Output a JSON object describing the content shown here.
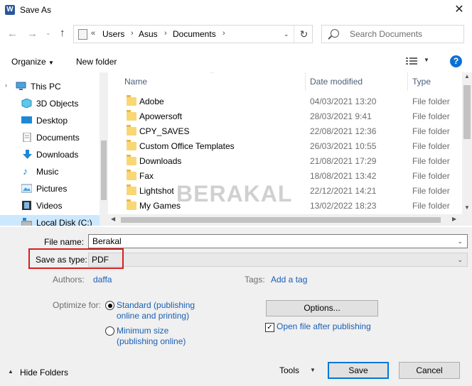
{
  "window": {
    "title": "Save As",
    "app_icon_letter": "W"
  },
  "address": {
    "prefix": "«",
    "crumbs": [
      "Users",
      "Asus",
      "Documents"
    ]
  },
  "search": {
    "placeholder": "Search Documents"
  },
  "toolbar": {
    "organize": "Organize",
    "new_folder": "New folder"
  },
  "nav": {
    "items": [
      {
        "label": "This PC",
        "icon": "pc-icon"
      },
      {
        "label": "3D Objects",
        "icon": "cube-icon"
      },
      {
        "label": "Desktop",
        "icon": "desktop-icon"
      },
      {
        "label": "Documents",
        "icon": "documents-icon"
      },
      {
        "label": "Downloads",
        "icon": "download-arrow-icon"
      },
      {
        "label": "Music",
        "icon": "music-note-icon"
      },
      {
        "label": "Pictures",
        "icon": "pictures-icon"
      },
      {
        "label": "Videos",
        "icon": "film-icon"
      },
      {
        "label": "Local Disk (C:)",
        "icon": "drive-icon"
      }
    ]
  },
  "files": {
    "columns": {
      "name": "Name",
      "date": "Date modified",
      "type": "Type"
    },
    "rows": [
      {
        "name": "Adobe",
        "date": "04/03/2021 13:20",
        "type": "File folder"
      },
      {
        "name": "Apowersoft",
        "date": "28/03/2021 9:41",
        "type": "File folder"
      },
      {
        "name": "CPY_SAVES",
        "date": "22/08/2021 12:36",
        "type": "File folder"
      },
      {
        "name": "Custom Office Templates",
        "date": "26/03/2021 10:55",
        "type": "File folder"
      },
      {
        "name": "Downloads",
        "date": "21/08/2021 17:29",
        "type": "File folder"
      },
      {
        "name": "Fax",
        "date": "18/08/2021 13:42",
        "type": "File folder"
      },
      {
        "name": "Lightshot",
        "date": "22/12/2021 14:21",
        "type": "File folder"
      },
      {
        "name": "My Games",
        "date": "13/02/2022 18:23",
        "type": "File folder"
      }
    ]
  },
  "watermark": "BERAKAL",
  "form": {
    "file_name_label": "File name:",
    "file_name_value": "Berakal",
    "save_type_label": "Save as type:",
    "save_type_value": "PDF",
    "authors_label": "Authors:",
    "authors_value": "daffa",
    "tags_label": "Tags:",
    "tags_value": "Add a tag",
    "optimize_label": "Optimize for:",
    "opt_standard_line1": "Standard (publishing",
    "opt_standard_line2": "online and printing)",
    "opt_min_line1": "Minimum size",
    "opt_min_line2": "(publishing online)",
    "options_button": "Options...",
    "open_after_label": "Open file after publishing",
    "open_after_checked": true
  },
  "footer": {
    "hide_folders": "Hide Folders",
    "tools": "Tools",
    "save": "Save",
    "cancel": "Cancel"
  },
  "colors": {
    "link": "#1a5fb4",
    "highlight": "#d81e1e",
    "accent": "#0078d7"
  }
}
